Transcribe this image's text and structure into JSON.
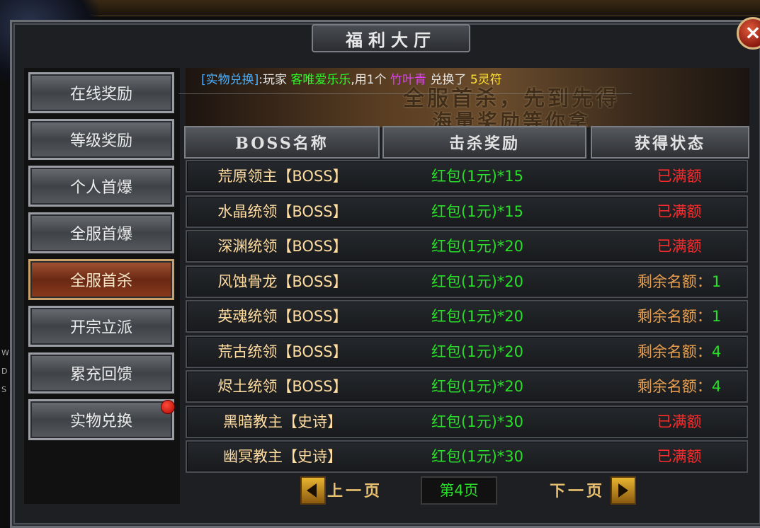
{
  "window": {
    "title": "福利大厅",
    "close_symbol": "×"
  },
  "menu": [
    {
      "label": "在线奖励",
      "active": false,
      "badge": false
    },
    {
      "label": "等级奖励",
      "active": false,
      "badge": false
    },
    {
      "label": "个人首爆",
      "active": false,
      "badge": false
    },
    {
      "label": "全服首爆",
      "active": false,
      "badge": false
    },
    {
      "label": "全服首杀",
      "active": true,
      "badge": false
    },
    {
      "label": "开宗立派",
      "active": false,
      "badge": false
    },
    {
      "label": "累充回馈",
      "active": false,
      "badge": false
    },
    {
      "label": "实物兑换",
      "active": false,
      "badge": true
    }
  ],
  "notice": {
    "tag": "[实物兑换]",
    "p1": ":玩家 ",
    "player": "客唯爱乐乐",
    "p2": ",用1个 ",
    "item": "竹叶青",
    "p3": " 兑换了 ",
    "gain": "5灵符"
  },
  "banner": {
    "line1": "全服首杀，先到先得",
    "line2": "海量奖励等你拿"
  },
  "table": {
    "headers": [
      "BOSS名称",
      "击杀奖励",
      "获得状态"
    ],
    "rows": [
      {
        "name": "荒原领主【BOSS】",
        "reward": "红包(1元)*15",
        "status": "已满额",
        "left": ""
      },
      {
        "name": "水晶统领【BOSS】",
        "reward": "红包(1元)*15",
        "status": "已满额",
        "left": ""
      },
      {
        "name": "深渊统领【BOSS】",
        "reward": "红包(1元)*20",
        "status": "已满额",
        "left": ""
      },
      {
        "name": "风蚀骨龙【BOSS】",
        "reward": "红包(1元)*20",
        "status": "剩余名额：",
        "left": "1"
      },
      {
        "name": "英魂统领【BOSS】",
        "reward": "红包(1元)*20",
        "status": "剩余名额：",
        "left": "1"
      },
      {
        "name": "荒古统领【BOSS】",
        "reward": "红包(1元)*20",
        "status": "剩余名额：",
        "left": "4"
      },
      {
        "name": "烬土统领【BOSS】",
        "reward": "红包(1元)*20",
        "status": "剩余名额：",
        "left": "4"
      },
      {
        "name": "黑暗教主【史诗】",
        "reward": "红包(1元)*30",
        "status": "已满额",
        "left": ""
      },
      {
        "name": "幽冥教主【史诗】",
        "reward": "红包(1元)*30",
        "status": "已满额",
        "left": ""
      }
    ]
  },
  "pager": {
    "prev": "上一页",
    "current": "第4页",
    "next": "下一页"
  },
  "side_letters": [
    "W",
    "D",
    "S"
  ]
}
